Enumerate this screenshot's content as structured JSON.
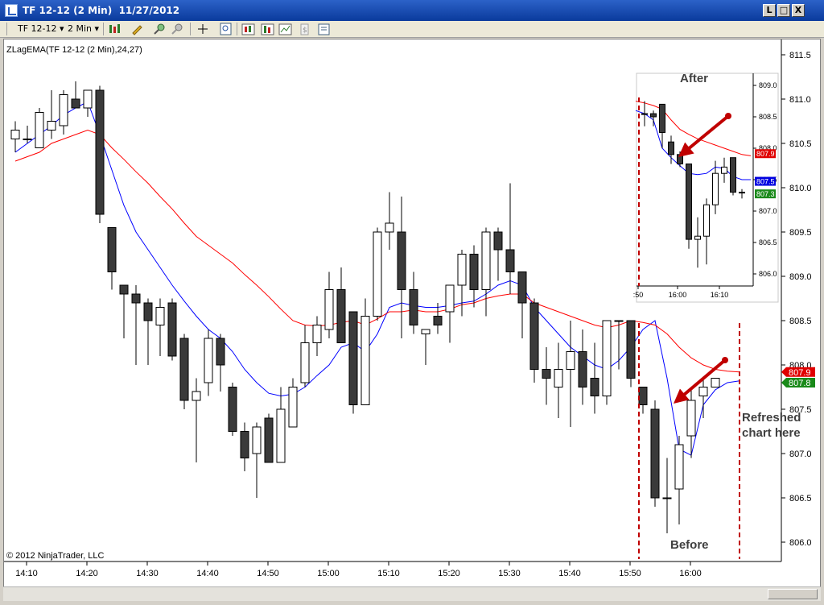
{
  "window": {
    "title": "TF 12-12 (2 Min)  11/27/2012",
    "btn_minimize": "L",
    "btn_maximize": "□",
    "btn_close": "X"
  },
  "toolbar": {
    "instrument": "TF 12-12",
    "interval": "2 Min",
    "icons": [
      "chart-style-icon",
      "drawing-pencil-icon",
      "zoom-in-icon",
      "zoom-out-icon",
      "crosshair-icon",
      "magnify-icon",
      "bar-type-icon",
      "indicator-icon",
      "strategy-icon",
      "data-box-icon",
      "properties-icon"
    ]
  },
  "chart": {
    "indicator_label": "ZLagEMA(TF 12-12 (2 Min),24,27)",
    "copyright": "© 2012 NinjaTrader, LLC",
    "price_ticks": [
      "811.5",
      "811.0",
      "810.5",
      "810.0",
      "809.5",
      "809.0",
      "808.5",
      "808.0",
      "807.5",
      "807.0",
      "806.5",
      "806.0"
    ],
    "time_ticks": [
      "14:10",
      "14:20",
      "14:30",
      "14:40",
      "14:50",
      "15:00",
      "15:10",
      "15:20",
      "15:30",
      "15:40",
      "15:50",
      "16:00"
    ],
    "red_label": "807.9",
    "green_label": "807.8",
    "colors": {
      "up": "#ffffff",
      "down": "#3a3a3a",
      "blue": "#0000ff",
      "red": "#ff0000",
      "annotation_line": "#c00000"
    }
  },
  "inset": {
    "price_ticks": [
      "809.0",
      "808.5",
      "808.0",
      "807.5",
      "807.0",
      "806.5",
      "806.0"
    ],
    "time_ticks": [
      ":50",
      "16:00",
      "16:10"
    ],
    "red_label": "807.9",
    "blue_label": "807.5",
    "green_label": "807.3"
  },
  "annotations": {
    "after": "After",
    "before": "Before",
    "refreshed_line1": "Refreshed",
    "refreshed_line2": "chart here"
  },
  "chart_data": {
    "type": "candlestick",
    "x_unit": "time (2 min bars)",
    "ylim": [
      805.85,
      811.6
    ],
    "candles": [
      {
        "o": 810.55,
        "h": 810.75,
        "l": 810.4,
        "c": 810.65
      },
      {
        "o": 810.55,
        "h": 810.7,
        "l": 810.5,
        "c": 810.55
      },
      {
        "o": 810.45,
        "h": 810.9,
        "l": 810.45,
        "c": 810.85
      },
      {
        "o": 810.65,
        "h": 811.1,
        "l": 810.55,
        "c": 810.75
      },
      {
        "o": 810.7,
        "h": 811.1,
        "l": 810.6,
        "c": 811.05
      },
      {
        "o": 811.0,
        "h": 811.2,
        "l": 810.95,
        "c": 810.9
      },
      {
        "o": 810.9,
        "h": 811.1,
        "l": 810.8,
        "c": 811.1
      },
      {
        "o": 811.1,
        "h": 811.15,
        "l": 809.6,
        "c": 809.7
      },
      {
        "o": 809.55,
        "h": 809.55,
        "l": 808.85,
        "c": 809.05
      },
      {
        "o": 808.9,
        "h": 808.9,
        "l": 808.3,
        "c": 808.8
      },
      {
        "o": 808.8,
        "h": 808.9,
        "l": 808.0,
        "c": 808.7
      },
      {
        "o": 808.7,
        "h": 808.75,
        "l": 808.0,
        "c": 808.5
      },
      {
        "o": 808.45,
        "h": 808.75,
        "l": 808.1,
        "c": 808.65
      },
      {
        "o": 808.7,
        "h": 808.75,
        "l": 808.05,
        "c": 808.1
      },
      {
        "o": 808.3,
        "h": 808.35,
        "l": 807.5,
        "c": 807.6
      },
      {
        "o": 807.6,
        "h": 807.85,
        "l": 806.9,
        "c": 807.7
      },
      {
        "o": 807.8,
        "h": 808.4,
        "l": 807.65,
        "c": 808.3
      },
      {
        "o": 808.3,
        "h": 808.35,
        "l": 807.7,
        "c": 808.0
      },
      {
        "o": 807.75,
        "h": 807.8,
        "l": 807.2,
        "c": 807.25
      },
      {
        "o": 807.25,
        "h": 807.35,
        "l": 806.8,
        "c": 806.95
      },
      {
        "o": 807.0,
        "h": 807.35,
        "l": 806.5,
        "c": 807.3
      },
      {
        "o": 807.4,
        "h": 807.45,
        "l": 806.9,
        "c": 806.9
      },
      {
        "o": 806.9,
        "h": 807.75,
        "l": 806.9,
        "c": 807.5
      },
      {
        "o": 807.3,
        "h": 807.85,
        "l": 807.3,
        "c": 807.75
      },
      {
        "o": 807.8,
        "h": 808.45,
        "l": 807.75,
        "c": 808.25
      },
      {
        "o": 808.25,
        "h": 808.55,
        "l": 808.1,
        "c": 808.45
      },
      {
        "o": 808.4,
        "h": 809.05,
        "l": 808.3,
        "c": 808.85
      },
      {
        "o": 808.85,
        "h": 809.1,
        "l": 808.35,
        "c": 808.25
      },
      {
        "o": 808.6,
        "h": 808.6,
        "l": 807.45,
        "c": 807.55
      },
      {
        "o": 807.55,
        "h": 808.75,
        "l": 807.55,
        "c": 808.55
      },
      {
        "o": 808.55,
        "h": 809.55,
        "l": 808.5,
        "c": 809.5
      },
      {
        "o": 809.5,
        "h": 809.95,
        "l": 809.3,
        "c": 809.6
      },
      {
        "o": 809.5,
        "h": 809.9,
        "l": 808.3,
        "c": 808.85
      },
      {
        "o": 808.85,
        "h": 809.05,
        "l": 808.35,
        "c": 808.45
      },
      {
        "o": 808.35,
        "h": 808.4,
        "l": 808.0,
        "c": 808.4
      },
      {
        "o": 808.55,
        "h": 808.7,
        "l": 808.35,
        "c": 808.45
      },
      {
        "o": 808.6,
        "h": 808.75,
        "l": 808.25,
        "c": 808.9
      },
      {
        "o": 808.9,
        "h": 809.3,
        "l": 808.55,
        "c": 809.25
      },
      {
        "o": 809.25,
        "h": 809.35,
        "l": 808.65,
        "c": 808.85
      },
      {
        "o": 808.85,
        "h": 809.55,
        "l": 808.55,
        "c": 809.5
      },
      {
        "o": 809.5,
        "h": 809.55,
        "l": 808.95,
        "c": 809.3
      },
      {
        "o": 809.3,
        "h": 810.05,
        "l": 808.8,
        "c": 809.05
      },
      {
        "o": 809.05,
        "h": 809.05,
        "l": 808.3,
        "c": 808.7
      },
      {
        "o": 808.7,
        "h": 808.75,
        "l": 807.8,
        "c": 807.95
      },
      {
        "o": 807.95,
        "h": 808.2,
        "l": 807.55,
        "c": 807.85
      },
      {
        "o": 807.75,
        "h": 808.25,
        "l": 807.4,
        "c": 807.95
      },
      {
        "o": 807.95,
        "h": 808.5,
        "l": 807.3,
        "c": 808.15
      },
      {
        "o": 808.15,
        "h": 808.4,
        "l": 807.55,
        "c": 807.75
      },
      {
        "o": 807.85,
        "h": 808.25,
        "l": 807.45,
        "c": 807.65
      },
      {
        "o": 807.65,
        "h": 808.45,
        "l": 807.55,
        "c": 808.5
      },
      {
        "o": 808.5,
        "h": 808.5,
        "l": 807.95,
        "c": 808.5
      },
      {
        "o": 808.5,
        "h": 808.5,
        "l": 807.75,
        "c": 807.85
      },
      {
        "o": 807.75,
        "h": 807.75,
        "l": 807.45,
        "c": 807.55
      },
      {
        "o": 807.5,
        "h": 807.6,
        "l": 806.4,
        "c": 806.5
      },
      {
        "o": 806.5,
        "h": 806.95,
        "l": 806.1,
        "c": 806.5
      },
      {
        "o": 806.6,
        "h": 807.2,
        "l": 806.2,
        "c": 807.1
      },
      {
        "o": 807.2,
        "h": 807.75,
        "l": 806.95,
        "c": 807.6
      },
      {
        "o": 807.65,
        "h": 807.85,
        "l": 807.4,
        "c": 807.75
      },
      {
        "o": 807.75,
        "h": 807.85,
        "l": 807.75,
        "c": 807.85
      }
    ],
    "series": [
      {
        "color": "#0000ff",
        "values": [
          810.4,
          810.5,
          810.6,
          810.7,
          810.82,
          810.9,
          810.97,
          810.6,
          810.2,
          809.8,
          809.5,
          809.3,
          809.1,
          808.9,
          808.72,
          808.55,
          808.4,
          808.3,
          808.15,
          807.95,
          807.8,
          807.68,
          807.65,
          807.67,
          807.75,
          807.88,
          808.0,
          808.2,
          808.25,
          808.15,
          808.35,
          808.65,
          808.7,
          808.67,
          808.65,
          808.65,
          808.67,
          808.7,
          808.72,
          808.8,
          808.9,
          808.95,
          808.9,
          808.65,
          808.5,
          808.35,
          808.2,
          808.1,
          808.0,
          807.95,
          808.05,
          808.2,
          808.4,
          808.5,
          807.85,
          807.05,
          806.98,
          807.55,
          807.72,
          807.8,
          807.82
        ]
      },
      {
        "color": "#ff0000",
        "values": [
          810.3,
          810.35,
          810.4,
          810.5,
          810.55,
          810.6,
          810.65,
          810.6,
          810.45,
          810.32,
          810.18,
          810.05,
          809.9,
          809.76,
          809.6,
          809.45,
          809.35,
          809.25,
          809.15,
          809.02,
          808.9,
          808.77,
          808.63,
          808.5,
          808.45,
          808.44,
          808.45,
          808.48,
          808.5,
          808.45,
          808.52,
          808.6,
          808.6,
          808.62,
          808.6,
          808.6,
          808.63,
          808.68,
          808.7,
          808.75,
          808.78,
          808.8,
          808.8,
          808.7,
          808.65,
          808.6,
          808.55,
          808.5,
          808.45,
          808.42,
          808.45,
          808.5,
          808.48,
          808.45,
          808.35,
          808.2,
          808.08,
          808.0,
          807.95,
          807.93,
          807.92
        ]
      }
    ]
  }
}
